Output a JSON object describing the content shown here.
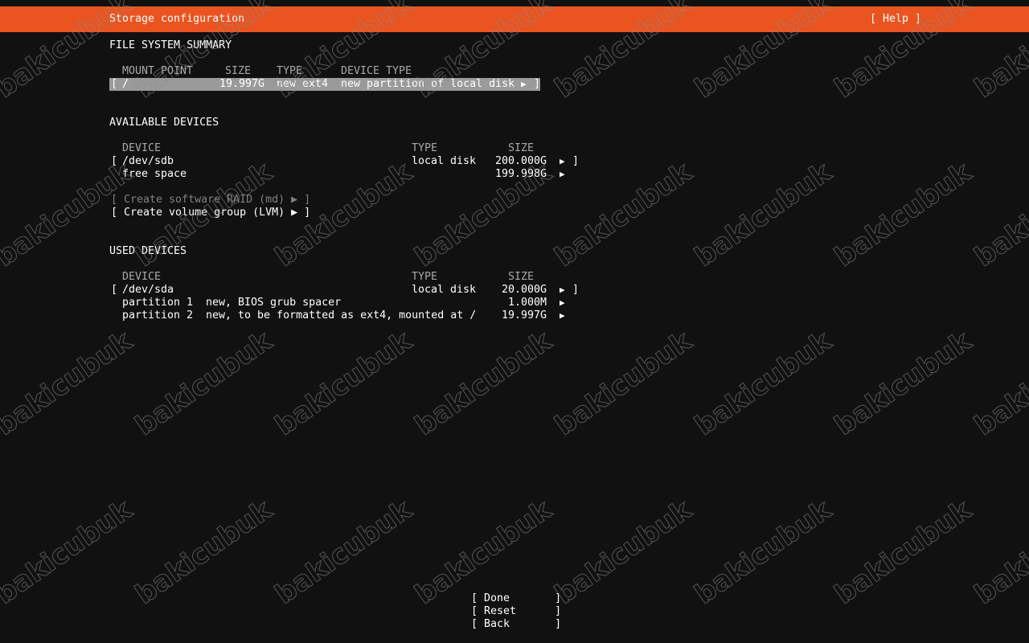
{
  "header": {
    "title": "Storage configuration",
    "help_label": "[ Help ]"
  },
  "fs_summary": {
    "heading": "FILE SYSTEM SUMMARY",
    "columns": {
      "mount_point": "MOUNT POINT",
      "size": "SIZE",
      "type": "TYPE",
      "device_type": "DEVICE TYPE"
    },
    "row": {
      "open": "[",
      "mount_point": "/",
      "size": "19.997G",
      "type": "new ext4",
      "device_type": "new partition of local disk",
      "arrow": "▶",
      "close": "]"
    }
  },
  "available": {
    "heading": "AVAILABLE DEVICES",
    "columns": {
      "device": "DEVICE",
      "type": "TYPE",
      "size": "SIZE"
    },
    "disk": {
      "open": "[",
      "name": "/dev/sdb",
      "type": "local disk",
      "size": "200.000G",
      "arrow": "▶",
      "close": "]"
    },
    "free": {
      "name": "free space",
      "size": "199.998G",
      "arrow": "▶"
    },
    "raid_button": "[ Create software RAID (md) ▶ ]",
    "lvm_button": "[ Create volume group (LVM) ▶ ]"
  },
  "used": {
    "heading": "USED DEVICES",
    "columns": {
      "device": "DEVICE",
      "type": "TYPE",
      "size": "SIZE"
    },
    "disk": {
      "open": "[",
      "name": "/dev/sda",
      "type": "local disk",
      "size": "20.000G",
      "arrow": "▶",
      "close": "]"
    },
    "partitions": [
      {
        "name": "partition 1",
        "desc": "new, BIOS grub spacer",
        "size": "1.000M",
        "arrow": "▶"
      },
      {
        "name": "partition 2",
        "desc": "new, to be formatted as ext4, mounted at /",
        "size": "19.997G",
        "arrow": "▶"
      }
    ]
  },
  "footer": {
    "done_label": "[ Done       ]",
    "reset_label": "[ Reset      ]",
    "back_label": "[ Back       ]"
  },
  "watermark": {
    "text": "bakicubuk"
  },
  "colors": {
    "accent": "#e95420",
    "background": "#111111",
    "selection": "#9a9a9a",
    "text": "#ffffff",
    "disabled": "#808080"
  }
}
